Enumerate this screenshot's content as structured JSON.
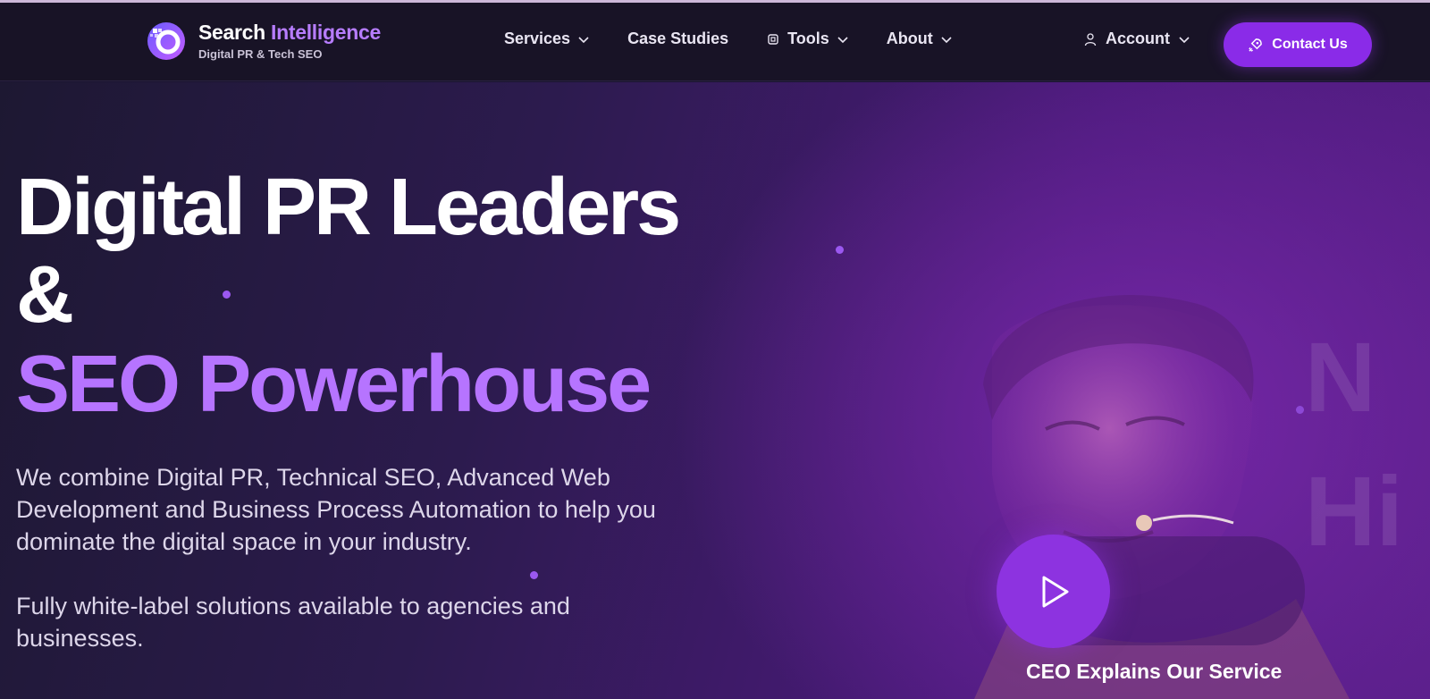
{
  "brand": {
    "name_first": "Search",
    "name_second": "Intelligence",
    "tagline": "Digital PR & Tech SEO",
    "logo_icon": "ring-logo-icon"
  },
  "nav": {
    "items": [
      {
        "label": "Services",
        "has_dropdown": true
      },
      {
        "label": "Case Studies",
        "has_dropdown": false
      },
      {
        "label": "Tools",
        "has_dropdown": true,
        "icon": "chip-icon"
      },
      {
        "label": "About",
        "has_dropdown": true
      }
    ],
    "account_label": "Account",
    "contact_label": "Contact Us"
  },
  "hero": {
    "headline_line1": "Digital PR Leaders",
    "headline_line2": "&",
    "headline_line3": "SEO Powerhouse",
    "paragraph1": "We combine Digital PR, Technical SEO, Advanced Web Development and Business Process Automation to help you dominate the digital space in your industry.",
    "paragraph2": "Fully white-label solutions available to agencies and businesses.",
    "video_caption": "CEO Explains Our Service"
  },
  "colors": {
    "accent": "#b674ff",
    "button": "#8a2be8",
    "navbar_bg": "#181326"
  }
}
